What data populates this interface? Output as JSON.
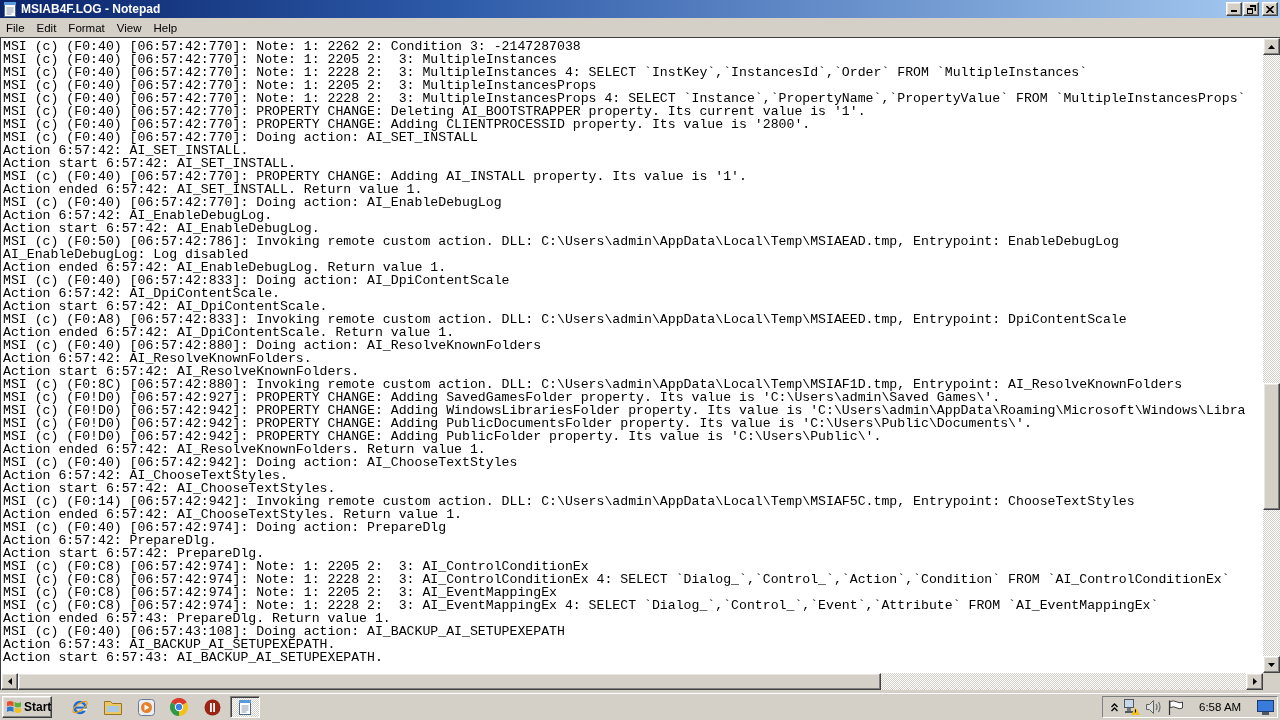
{
  "window": {
    "title": "MSIAB4F.LOG - Notepad"
  },
  "menu": [
    "File",
    "Edit",
    "Format",
    "View",
    "Help"
  ],
  "document": {
    "lines": [
      "MSI (c) (F0:40) [06:57:42:770]: Note: 1: 2262 2: Condition 3: -2147287038",
      "MSI (c) (F0:40) [06:57:42:770]: Note: 1: 2205 2:  3: MultipleInstances",
      "MSI (c) (F0:40) [06:57:42:770]: Note: 1: 2228 2:  3: MultipleInstances 4: SELECT `InstKey`,`InstancesId`,`Order` FROM `MultipleInstances`",
      "MSI (c) (F0:40) [06:57:42:770]: Note: 1: 2205 2:  3: MultipleInstancesProps",
      "MSI (c) (F0:40) [06:57:42:770]: Note: 1: 2228 2:  3: MultipleInstancesProps 4: SELECT `Instance`,`PropertyName`,`PropertyValue` FROM `MultipleInstancesProps`",
      "MSI (c) (F0:40) [06:57:42:770]: PROPERTY CHANGE: Deleting AI_BOOTSTRAPPER property. Its current value is '1'.",
      "MSI (c) (F0:40) [06:57:42:770]: PROPERTY CHANGE: Adding CLIENTPROCESSID property. Its value is '2800'.",
      "MSI (c) (F0:40) [06:57:42:770]: Doing action: AI_SET_INSTALL",
      "Action 6:57:42: AI_SET_INSTALL.",
      "Action start 6:57:42: AI_SET_INSTALL.",
      "MSI (c) (F0:40) [06:57:42:770]: PROPERTY CHANGE: Adding AI_INSTALL property. Its value is '1'.",
      "Action ended 6:57:42: AI_SET_INSTALL. Return value 1.",
      "MSI (c) (F0:40) [06:57:42:770]: Doing action: AI_EnableDebugLog",
      "Action 6:57:42: AI_EnableDebugLog.",
      "Action start 6:57:42: AI_EnableDebugLog.",
      "MSI (c) (F0:50) [06:57:42:786]: Invoking remote custom action. DLL: C:\\Users\\admin\\AppData\\Local\\Temp\\MSIAEAD.tmp, Entrypoint: EnableDebugLog",
      "AI_EnableDebugLog: Log disabled",
      "Action ended 6:57:42: AI_EnableDebugLog. Return value 1.",
      "MSI (c) (F0:40) [06:57:42:833]: Doing action: AI_DpiContentScale",
      "Action 6:57:42: AI_DpiContentScale.",
      "Action start 6:57:42: AI_DpiContentScale.",
      "MSI (c) (F0:A8) [06:57:42:833]: Invoking remote custom action. DLL: C:\\Users\\admin\\AppData\\Local\\Temp\\MSIAEED.tmp, Entrypoint: DpiContentScale",
      "Action ended 6:57:42: AI_DpiContentScale. Return value 1.",
      "MSI (c) (F0:40) [06:57:42:880]: Doing action: AI_ResolveKnownFolders",
      "Action 6:57:42: AI_ResolveKnownFolders.",
      "Action start 6:57:42: AI_ResolveKnownFolders.",
      "MSI (c) (F0:8C) [06:57:42:880]: Invoking remote custom action. DLL: C:\\Users\\admin\\AppData\\Local\\Temp\\MSIAF1D.tmp, Entrypoint: AI_ResolveKnownFolders",
      "MSI (c) (F0!D0) [06:57:42:927]: PROPERTY CHANGE: Adding SavedGamesFolder property. Its value is 'C:\\Users\\admin\\Saved Games\\'.",
      "MSI (c) (F0!D0) [06:57:42:942]: PROPERTY CHANGE: Adding WindowsLibrariesFolder property. Its value is 'C:\\Users\\admin\\AppData\\Roaming\\Microsoft\\Windows\\Libra",
      "MSI (c) (F0!D0) [06:57:42:942]: PROPERTY CHANGE: Adding PublicDocumentsFolder property. Its value is 'C:\\Users\\Public\\Documents\\'.",
      "MSI (c) (F0!D0) [06:57:42:942]: PROPERTY CHANGE: Adding PublicFolder property. Its value is 'C:\\Users\\Public\\'.",
      "Action ended 6:57:42: AI_ResolveKnownFolders. Return value 1.",
      "MSI (c) (F0:40) [06:57:42:942]: Doing action: AI_ChooseTextStyles",
      "Action 6:57:42: AI_ChooseTextStyles.",
      "Action start 6:57:42: AI_ChooseTextStyles.",
      "MSI (c) (F0:14) [06:57:42:942]: Invoking remote custom action. DLL: C:\\Users\\admin\\AppData\\Local\\Temp\\MSIAF5C.tmp, Entrypoint: ChooseTextStyles",
      "Action ended 6:57:42: AI_ChooseTextStyles. Return value 1.",
      "MSI (c) (F0:40) [06:57:42:974]: Doing action: PrepareDlg",
      "Action 6:57:42: PrepareDlg.",
      "Action start 6:57:42: PrepareDlg.",
      "MSI (c) (F0:C8) [06:57:42:974]: Note: 1: 2205 2:  3: AI_ControlConditionEx",
      "MSI (c) (F0:C8) [06:57:42:974]: Note: 1: 2228 2:  3: AI_ControlConditionEx 4: SELECT `Dialog_`,`Control_`,`Action`,`Condition` FROM `AI_ControlConditionEx`",
      "MSI (c) (F0:C8) [06:57:42:974]: Note: 1: 2205 2:  3: AI_EventMappingEx",
      "MSI (c) (F0:C8) [06:57:42:974]: Note: 1: 2228 2:  3: AI_EventMappingEx 4: SELECT `Dialog_`,`Control_`,`Event`,`Attribute` FROM `AI_EventMappingEx`",
      "Action ended 6:57:43: PrepareDlg. Return value 1.",
      "MSI (c) (F0:40) [06:57:43:108]: Doing action: AI_BACKUP_AI_SETUPEXEPATH",
      "Action 6:57:43: AI_BACKUP_AI_SETUPEXEPATH.",
      "Action start 6:57:43: AI_BACKUP_AI_SETUPEXEPATH."
    ]
  },
  "taskbar": {
    "start": "Start",
    "apps": [
      {
        "kind": "web",
        "selected": false
      },
      {
        "kind": "folder",
        "selected": false
      },
      {
        "kind": "media",
        "selected": false
      },
      {
        "kind": "circle",
        "selected": false
      },
      {
        "kind": "badge",
        "selected": false
      },
      {
        "kind": "notepad",
        "selected": true
      }
    ],
    "clock": "6:58 AM"
  }
}
